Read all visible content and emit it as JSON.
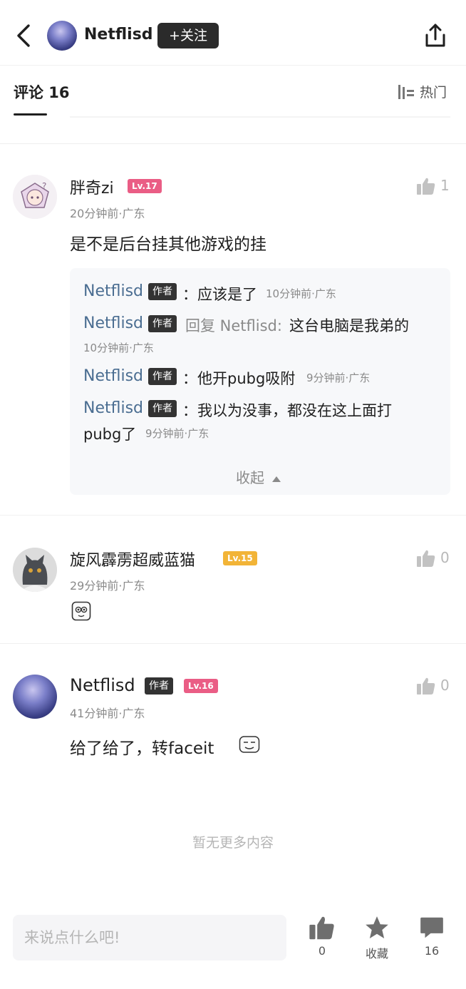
{
  "header": {
    "username": "Netflisd",
    "follow_label": "+关注"
  },
  "comments_header": {
    "tab_label": "评论 16",
    "sort_label": "热门"
  },
  "comments": [
    {
      "name": "胖奇zi",
      "level": "Lv.17",
      "meta": "20分钟前·广东",
      "text": "是不是后台挂其他游戏的挂",
      "likes": "1"
    },
    {
      "name": "旋风霹雳超威蓝猫",
      "level": "Lv.15",
      "meta": "29分钟前·广东",
      "text": "",
      "likes": "0"
    },
    {
      "name": "Netflisd",
      "author_badge": "作者",
      "level": "Lv.16",
      "meta": "41分钟前·广东",
      "text": "给了给了，转faceit",
      "likes": "0"
    }
  ],
  "replies": {
    "items": [
      {
        "name": "Netflisd",
        "badge": "作者",
        "text": "：应该是了",
        "time": "10分钟前·广东"
      },
      {
        "name": "Netflisd",
        "badge": "作者",
        "reply_prefix": "回复 Netflisd:",
        "text": "这台电脑是我弟的",
        "time": "10分钟前·广东"
      },
      {
        "name": "Netflisd",
        "badge": "作者",
        "text": "：他开pubg吸附",
        "time": "9分钟前·广东"
      },
      {
        "name": "Netflisd",
        "badge": "作者",
        "text": "：我以为没事，都没在这上面打",
        "text2": "pubg了",
        "time": "9分钟前·广东"
      }
    ],
    "collapse_label": "收起"
  },
  "footer_note": "暂无更多内容",
  "bottom_bar": {
    "input_placeholder": "来说点什么吧!",
    "like_count": "0",
    "favorite_label": "收藏",
    "comment_count": "16"
  }
}
